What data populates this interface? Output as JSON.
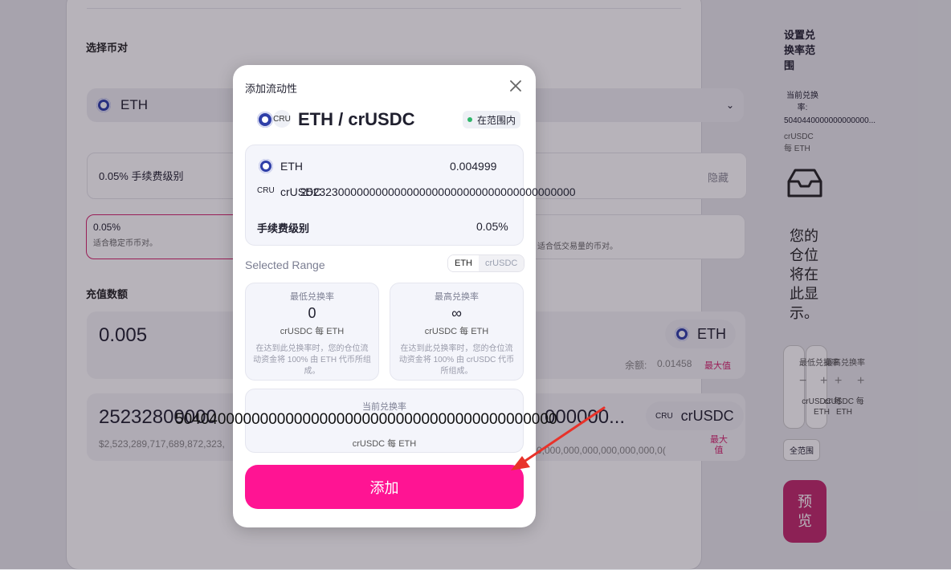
{
  "background": {
    "select_pair_title": "选择币对",
    "pair_token": "ETH",
    "fee_tier_label": "0.05% 手续费级别",
    "hide_label": "隐藏",
    "tier_selected_value": "0.05%",
    "tier_selected_desc": "适合稳定币币对。",
    "tier_right_desc": "适合低交易量的币对。",
    "deposit_title": "充值数额",
    "amount1_value": "0.005",
    "amount1_token": "ETH",
    "balance_label": "余额:",
    "balance_value": "0.01458",
    "max_label": "最大值",
    "amount2_value": "25232800000",
    "amount2_usd": "$2,523,289,717,689,872,323,",
    "amount2_tail": "000000...",
    "amount2_usd_tail": "0,000,000,000,000,000,000,0(",
    "amount2_token_prefix": "CRU",
    "amount2_token": "crUSDC",
    "max_label2": "最大值"
  },
  "right_panel": {
    "title": "设置兑换率范围",
    "current_rate_label": "当前兑换率:",
    "current_rate_value": "5040440000000000000...",
    "unit": "crUSDC 每 ETH",
    "empty_text": "您的仓位将在此显示。",
    "min_label": "最低兑换率",
    "max_label": "最高兑换率",
    "minus": "−",
    "plus": "+",
    "min_unit": "crUSDC 每 ETH",
    "max_unit": "crUSDC 每 ETH",
    "full_range": "全范围",
    "preview": "预览"
  },
  "modal": {
    "title": "添加流动性",
    "pair_prefix": "CRU",
    "pair_name": "ETH / crUSDC",
    "status": "在范围内",
    "token1_name": "ETH",
    "token1_amount": "0.004999",
    "token2_prefix": "CRU",
    "token2_name": "crUSDC",
    "token2_amount": "25232300000000000000000000000000000000000000",
    "fee_label": "手续费级别",
    "fee_value": "0.05%",
    "selected_range": "Selected Range",
    "toggle_eth": "ETH",
    "toggle_crusdc": "crUSDC",
    "min": {
      "label": "最低兑换率",
      "value": "0",
      "unit": "crUSDC 每 ETH",
      "desc": "在达到此兑换率时，您的仓位流动资金将 100% 由 ETH 代币所组成。"
    },
    "max": {
      "label": "最高兑换率",
      "value": "∞",
      "unit": "crUSDC 每 ETH",
      "desc": "在达到此兑换率时，您的仓位流动资金将 100% 由 crUSDC 代币所组成。"
    },
    "current": {
      "label": "当前兑换率",
      "value": "504040000000000000000000000000000000000000000",
      "unit": "crUSDC 每 ETH"
    },
    "add_button": "添加"
  },
  "colors": {
    "accent": "#ff1493",
    "preview_bg": "#c0286b",
    "in_range_dot": "#2fb66a",
    "arrow": "#e8322a"
  }
}
